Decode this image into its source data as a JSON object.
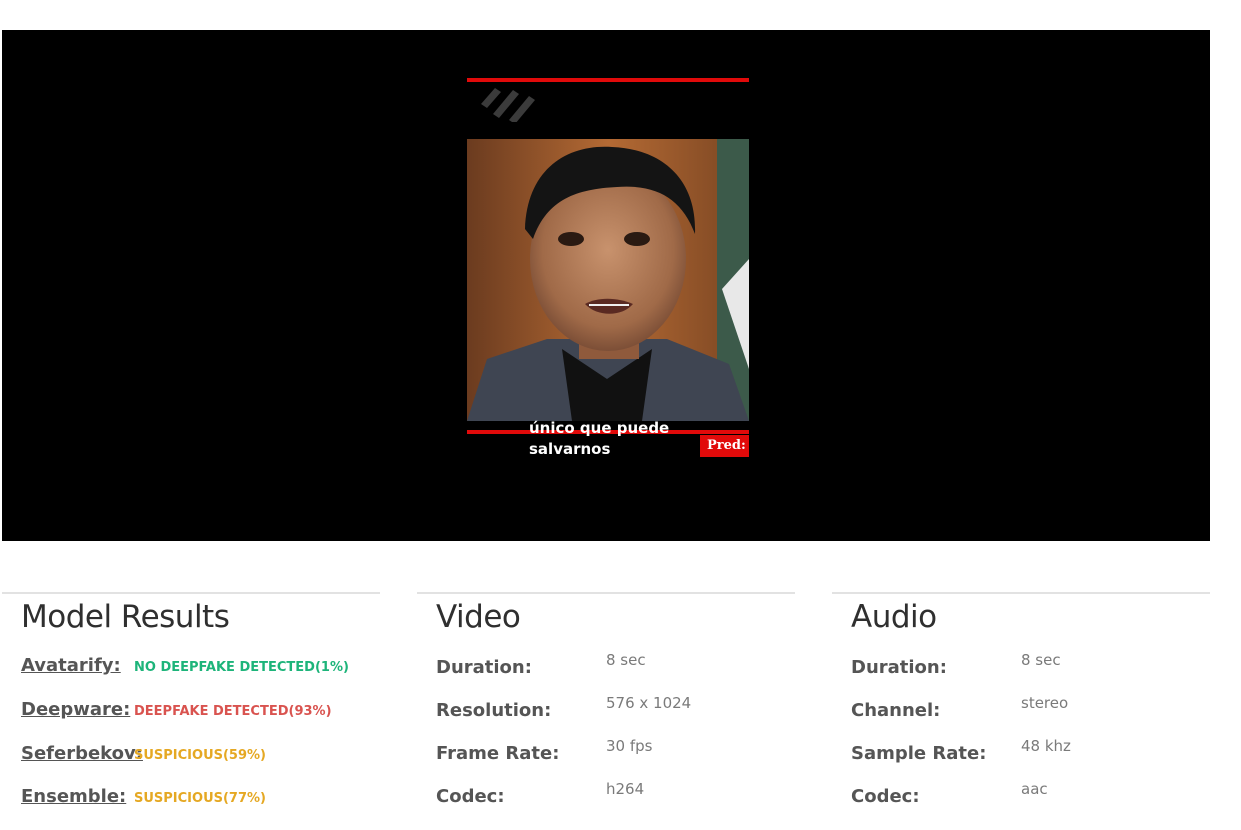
{
  "video_frame": {
    "caption_line1": "único que puede",
    "caption_line2": "salvarnos",
    "pred_label": "Pred: ("
  },
  "model_results": {
    "title": "Model Results",
    "items": [
      {
        "model": "Avatarify:",
        "result": "NO DEEPFAKE DETECTED(1%)",
        "color": "#1db47a"
      },
      {
        "model": "Deepware:",
        "result": "DEEPFAKE DETECTED(93%)",
        "color": "#d9534f"
      },
      {
        "model": "Seferbekov:",
        "result": "SUSPICIOUS(59%)",
        "color": "#e5a823"
      },
      {
        "model": "Ensemble:",
        "result": "SUSPICIOUS(77%)",
        "color": "#e5a823"
      }
    ]
  },
  "video": {
    "title": "Video",
    "rows": [
      {
        "label": "Duration:",
        "value": "8 sec"
      },
      {
        "label": "Resolution:",
        "value": "576 x 1024"
      },
      {
        "label": "Frame Rate:",
        "value": "30 fps"
      },
      {
        "label": "Codec:",
        "value": "h264"
      }
    ]
  },
  "audio": {
    "title": "Audio",
    "rows": [
      {
        "label": "Duration:",
        "value": "8 sec"
      },
      {
        "label": "Channel:",
        "value": "stereo"
      },
      {
        "label": "Sample Rate:",
        "value": "48 khz"
      },
      {
        "label": "Codec:",
        "value": "aac"
      }
    ]
  }
}
